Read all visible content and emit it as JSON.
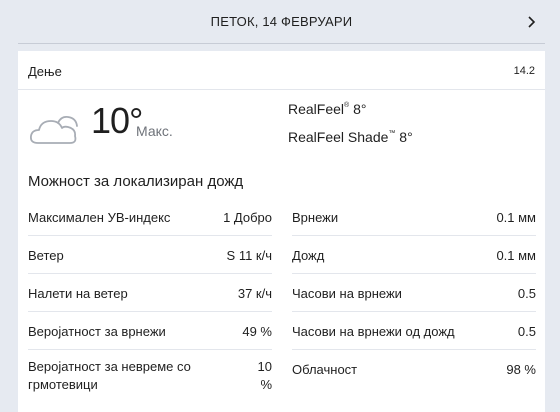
{
  "header": {
    "title": "ПЕТОК, 14 ФЕВРУАРИ",
    "chevron_icon": "chevron-right-icon"
  },
  "card": {
    "period_label": "Дење",
    "date": "14.2",
    "weather_icon": "cloudy-icon",
    "temperature": "10°",
    "temperature_label": "Макс.",
    "realfeel_label": "RealFeel",
    "realfeel_mark": "®",
    "realfeel_value": "8°",
    "realfeel_shade_label": "RealFeel Shade",
    "realfeel_shade_mark": "™",
    "realfeel_shade_value": "8°",
    "phrase": "Можност за локализиран дожд"
  },
  "details": {
    "left": [
      {
        "label": "Максимален УВ-индекс",
        "value": "1 Добро"
      },
      {
        "label": "Ветер",
        "value": "S 11 к/ч"
      },
      {
        "label": "Налети на ветер",
        "value": "37 к/ч"
      },
      {
        "label": "Веројатност за врнежи",
        "value": "49 %"
      },
      {
        "label": "Веројатност за невреме со грмотевици",
        "value": "10 %"
      }
    ],
    "right": [
      {
        "label": "Врнежи",
        "value": "0.1 мм"
      },
      {
        "label": "Дожд",
        "value": "0.1 мм"
      },
      {
        "label": "Часови на врнежи",
        "value": "0.5"
      },
      {
        "label": "Часови на врнежи од дожд",
        "value": "0.5"
      },
      {
        "label": "Облачност",
        "value": "98 %"
      }
    ]
  }
}
